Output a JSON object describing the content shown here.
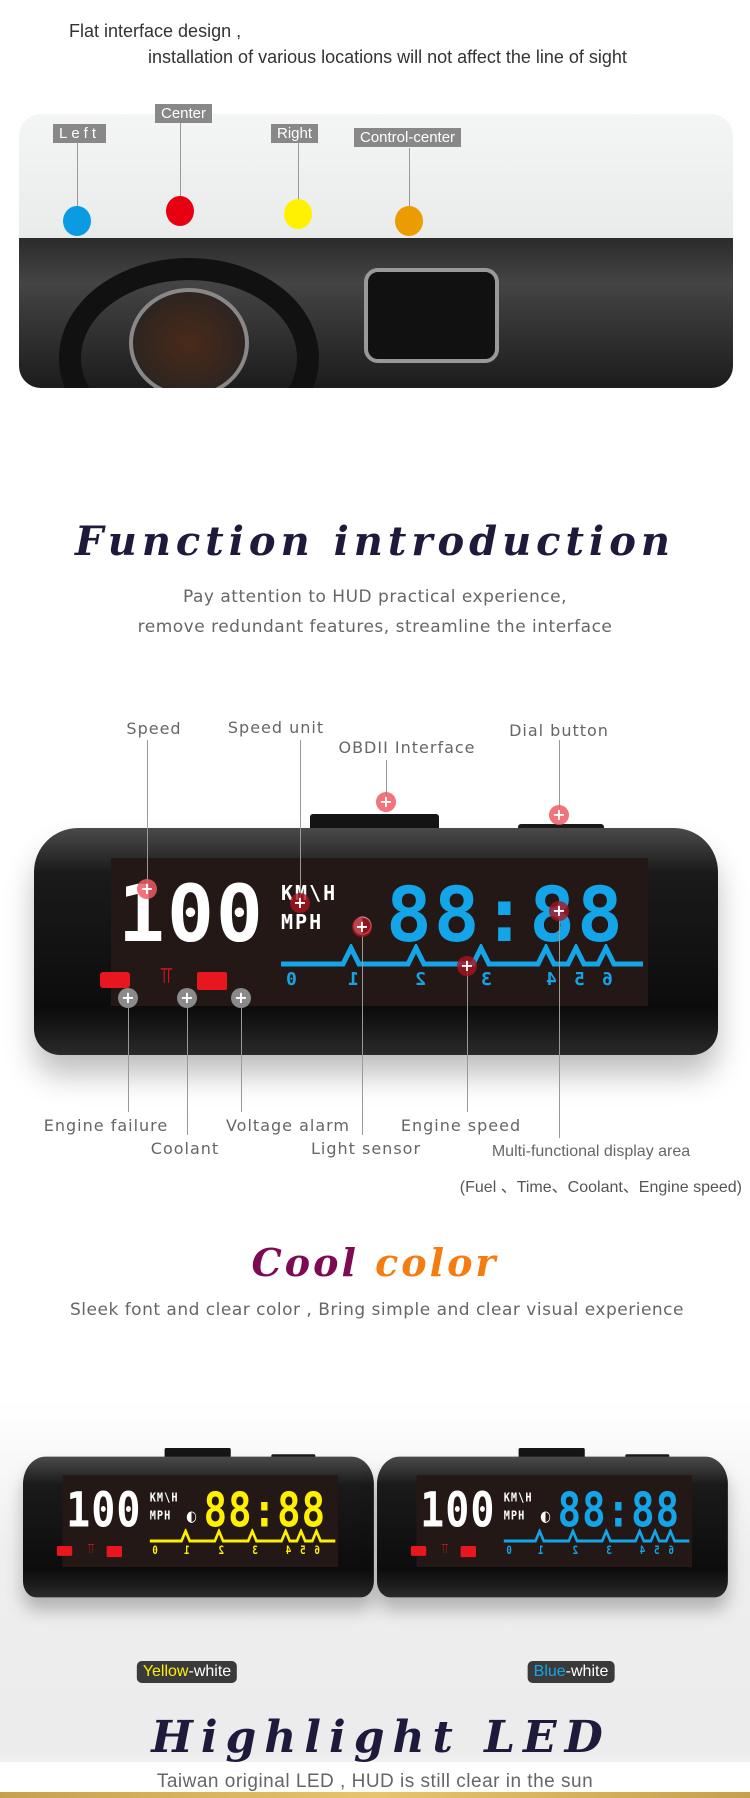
{
  "intro": {
    "line1": "Flat interface design ,",
    "line2": "installation of various locations will not affect the line of sight"
  },
  "positions": [
    {
      "label": "Left",
      "color": "#0a9be3"
    },
    {
      "label": "Center",
      "color": "#e60012"
    },
    {
      "label": "Right",
      "color": "#fff100"
    },
    {
      "label": "Control-center",
      "color": "#eb9c00"
    }
  ],
  "function": {
    "title": "Function introduction",
    "sub1": "Pay attention to HUD practical experience,",
    "sub2": "remove redundant features, streamline the interface",
    "labels": {
      "speed": "Speed",
      "speed_unit": "Speed unit",
      "obd": "OBDII Interface",
      "dial": "Dial button",
      "engine_failure": "Engine failure",
      "coolant": "Coolant",
      "voltage": "Voltage alarm",
      "light": "Light sensor",
      "engine_speed": "Engine speed",
      "multi": "Multi-functional display area",
      "multi_note": "(Fuel 、Time、Coolant、Engine speed)"
    }
  },
  "hud": {
    "speed": "100",
    "unit1": "KM\\H",
    "unit2": "MPH",
    "clock": "88:88",
    "rpm": [
      "0",
      "1",
      "2",
      "3",
      "4",
      "5",
      "6"
    ],
    "warn_color": "#e8161e"
  },
  "cool": {
    "title_a": "Cool",
    "title_b": "color",
    "sub": "Sleek font and clear color , Bring simple and clear visual experience",
    "color_a": "#7d0a52",
    "color_b": "#f57c10"
  },
  "variants": [
    {
      "accent": "Yellow",
      "rest": "-white",
      "color": "#fff000"
    },
    {
      "accent": "Blue",
      "rest": "-white",
      "color": "#14a5e8"
    }
  ],
  "led": {
    "title": "Highlight LED",
    "sub": "Taiwan original LED , HUD is still clear in the sun"
  }
}
